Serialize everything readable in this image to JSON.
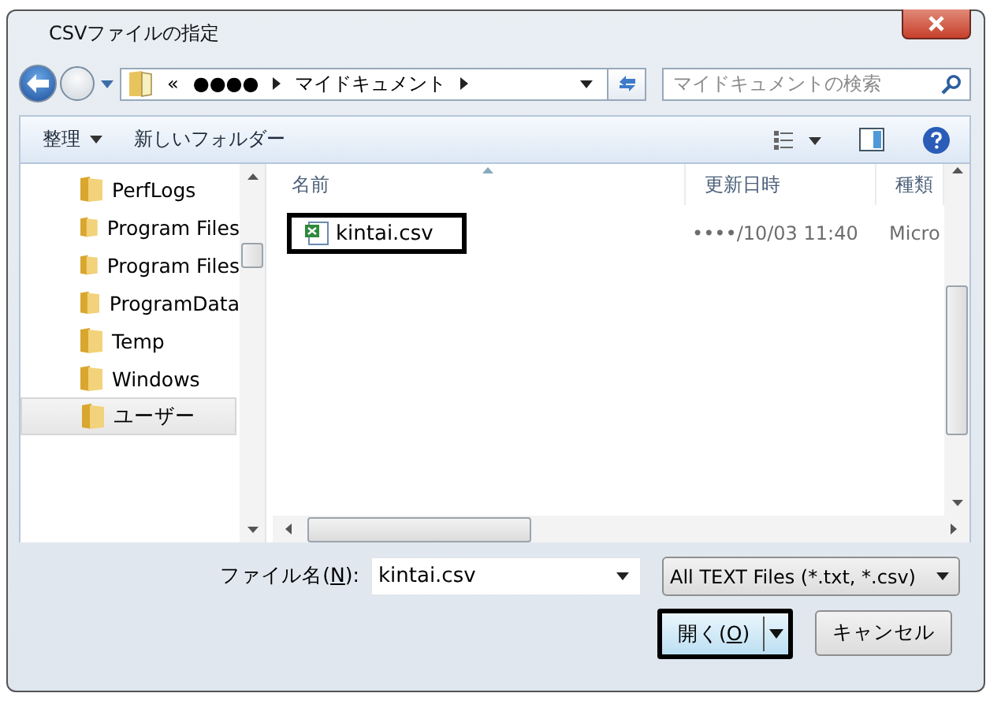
{
  "window": {
    "title": "CSVファイルの指定"
  },
  "address": {
    "overflow": "«",
    "parts": [
      "●●●●",
      "マイドキュメント"
    ]
  },
  "search": {
    "placeholder": "マイドキュメントの検索"
  },
  "toolbar": {
    "organize": "整理",
    "new_folder": "新しいフォルダー"
  },
  "nav": [
    {
      "label": "PerfLogs",
      "selected": false
    },
    {
      "label": "Program Files",
      "selected": false
    },
    {
      "label": "Program Files",
      "selected": false
    },
    {
      "label": "ProgramData",
      "selected": false
    },
    {
      "label": "Temp",
      "selected": false
    },
    {
      "label": "Windows",
      "selected": false
    },
    {
      "label": "ユーザー",
      "selected": true
    }
  ],
  "columns": [
    "名前",
    "更新日時",
    "種類"
  ],
  "files": [
    {
      "name": "kintai.csv",
      "modified": "••••/10/03 11:40",
      "type": "Micro",
      "highlighted": true
    }
  ],
  "filename": {
    "label_before": "ファイル名(",
    "label_key": "N",
    "label_after": "):",
    "value": "kintai.csv"
  },
  "filter": "All TEXT Files (*.txt, *.csv)",
  "open_button": {
    "before": "開く(",
    "key": "O",
    "after": ")",
    "highlighted": true
  },
  "cancel_button": "キャンセル"
}
